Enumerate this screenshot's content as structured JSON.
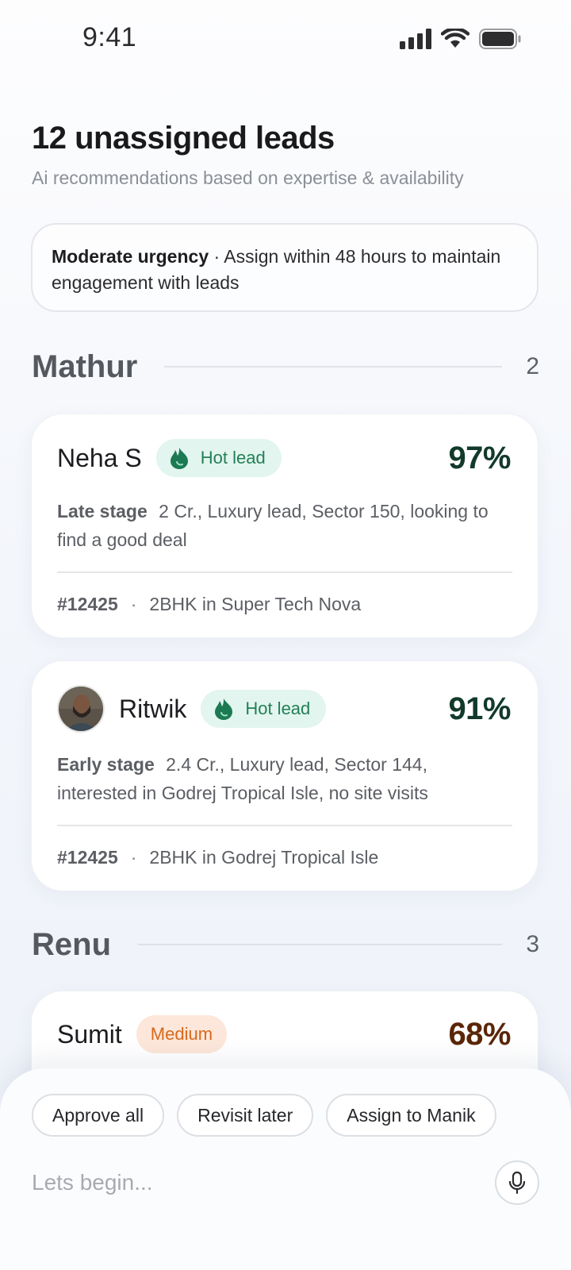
{
  "status_bar": {
    "time": "9:41",
    "icons": [
      "signal-icon",
      "wifi-icon",
      "battery-icon"
    ]
  },
  "header": {
    "title": "12 unassigned leads",
    "subtitle": "Ai recommendations based on expertise & availability"
  },
  "urgency": {
    "label": "Moderate urgency",
    "separator": " · ",
    "message": "Assign within 48 hours to maintain engagement with leads"
  },
  "groups": [
    {
      "name": "Mathur",
      "count": "2",
      "leads": [
        {
          "name": "Neha S",
          "badge": "Hot lead",
          "score": "97%",
          "stage": "Late stage",
          "description": "2 Cr., Luxury lead, Sector 150, looking to find a good deal",
          "id": "#12425",
          "dot": "·",
          "property": "2BHK in Super Tech Nova",
          "has_avatar": false
        },
        {
          "name": "Ritwik",
          "badge": "Hot lead",
          "score": "91%",
          "stage": "Early stage",
          "description": "2.4 Cr., Luxury lead, Sector 144, interested in Godrej Tropical Isle, no site visits",
          "id": "#12425",
          "dot": "·",
          "property": "2BHK in Godrej Tropical Isle",
          "has_avatar": true
        }
      ]
    },
    {
      "name": "Renu",
      "count": "3",
      "leads": [
        {
          "name": "Sumit",
          "badge": "Medium",
          "score": "68%"
        }
      ]
    }
  ],
  "actions": {
    "approve_all": "Approve all",
    "revisit_later": "Revisit later",
    "assign_to": "Assign to Manik"
  },
  "prompt": {
    "placeholder": "Lets begin..."
  },
  "colors": {
    "hot_badge_bg": "#e2f5ee",
    "hot_badge_text": "#237f59",
    "medium_badge_bg": "#fde6da",
    "medium_badge_text": "#d7691c",
    "score_high": "#123a2b",
    "score_medium": "#5a2608"
  }
}
